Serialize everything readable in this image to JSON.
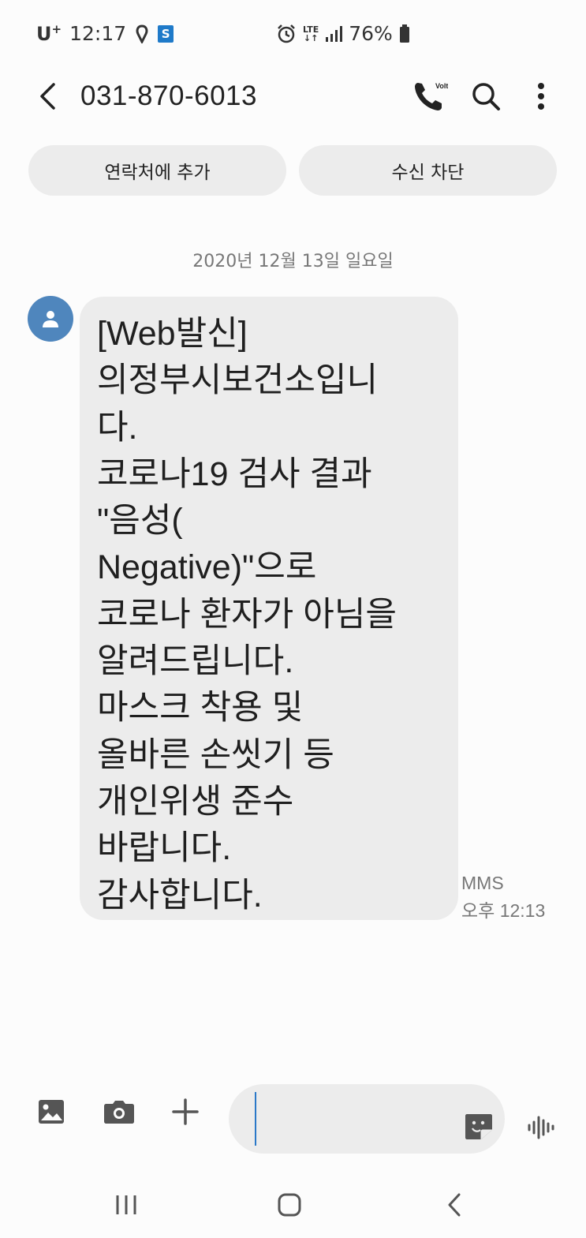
{
  "status_bar": {
    "carrier": "U",
    "carrier_plus": "+",
    "time": "12:17",
    "network": "LTE",
    "battery": "76%",
    "icons": [
      "location-icon",
      "s-app-icon",
      "alarm-icon",
      "lte-icon",
      "signal-icon",
      "battery-icon"
    ]
  },
  "header": {
    "title": "031-870-6013",
    "volte_label": "Volte",
    "icons": [
      "back-icon",
      "call-icon",
      "search-icon",
      "more-icon"
    ]
  },
  "actions": {
    "add_contact": "연락처에 추가",
    "block": "수신 차단"
  },
  "conversation": {
    "date": "2020년 12월 13일 일요일",
    "message": {
      "lines": [
        "[Web발신]",
        "의정부시보건소입니",
        "다.",
        "코로나19 검사 결과",
        "\"음성(",
        "Negative)\"으로",
        "코로나 환자가 아님을",
        "알려드립니다.",
        "마스크 착용 및",
        "올바른 손씻기 등",
        "개인위생 준수",
        "바랍니다.",
        "감사합니다."
      ],
      "type": "MMS",
      "time": "오후 12:13"
    }
  },
  "composer": {
    "icons": [
      "gallery-icon",
      "camera-icon",
      "plus-icon",
      "sticker-icon",
      "voice-icon"
    ]
  },
  "navbar": {
    "icons": [
      "recents-icon",
      "home-icon",
      "back-nav-icon"
    ]
  },
  "colors": {
    "accent": "#2a78c8",
    "bubble": "#ececec",
    "avatar": "#4f86bd"
  }
}
